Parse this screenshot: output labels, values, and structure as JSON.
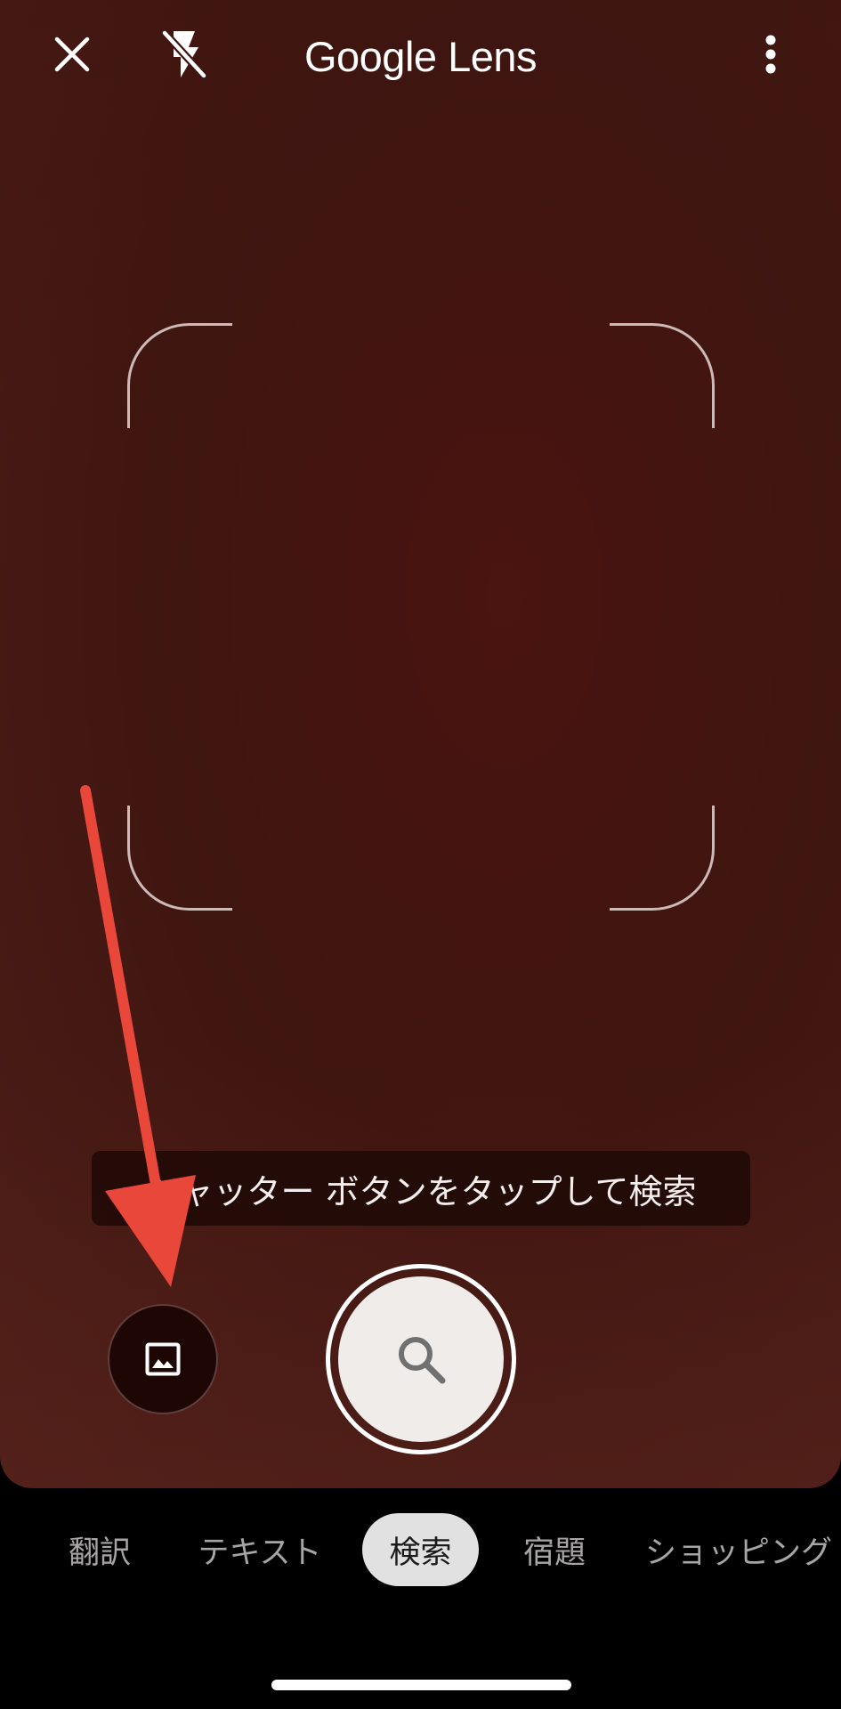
{
  "app": {
    "title_google": "Google",
    "title_lens": "Lens"
  },
  "icons": {
    "close": "close-icon",
    "flash": "flash-off-icon",
    "more": "more-vert-icon",
    "gallery": "image-icon",
    "shutter": "search-icon"
  },
  "hint": {
    "text": "シャッター ボタンをタップして検索"
  },
  "modes": {
    "items": [
      {
        "label": "翻訳",
        "selected": false
      },
      {
        "label": "テキスト",
        "selected": false
      },
      {
        "label": "検索",
        "selected": true
      },
      {
        "label": "宿題",
        "selected": false
      },
      {
        "label": "ショッピング",
        "selected": false
      }
    ]
  },
  "colors": {
    "viewfinder": "#451510",
    "annotation_arrow": "#e8473a",
    "selected_tab": "#e2e1e1"
  }
}
